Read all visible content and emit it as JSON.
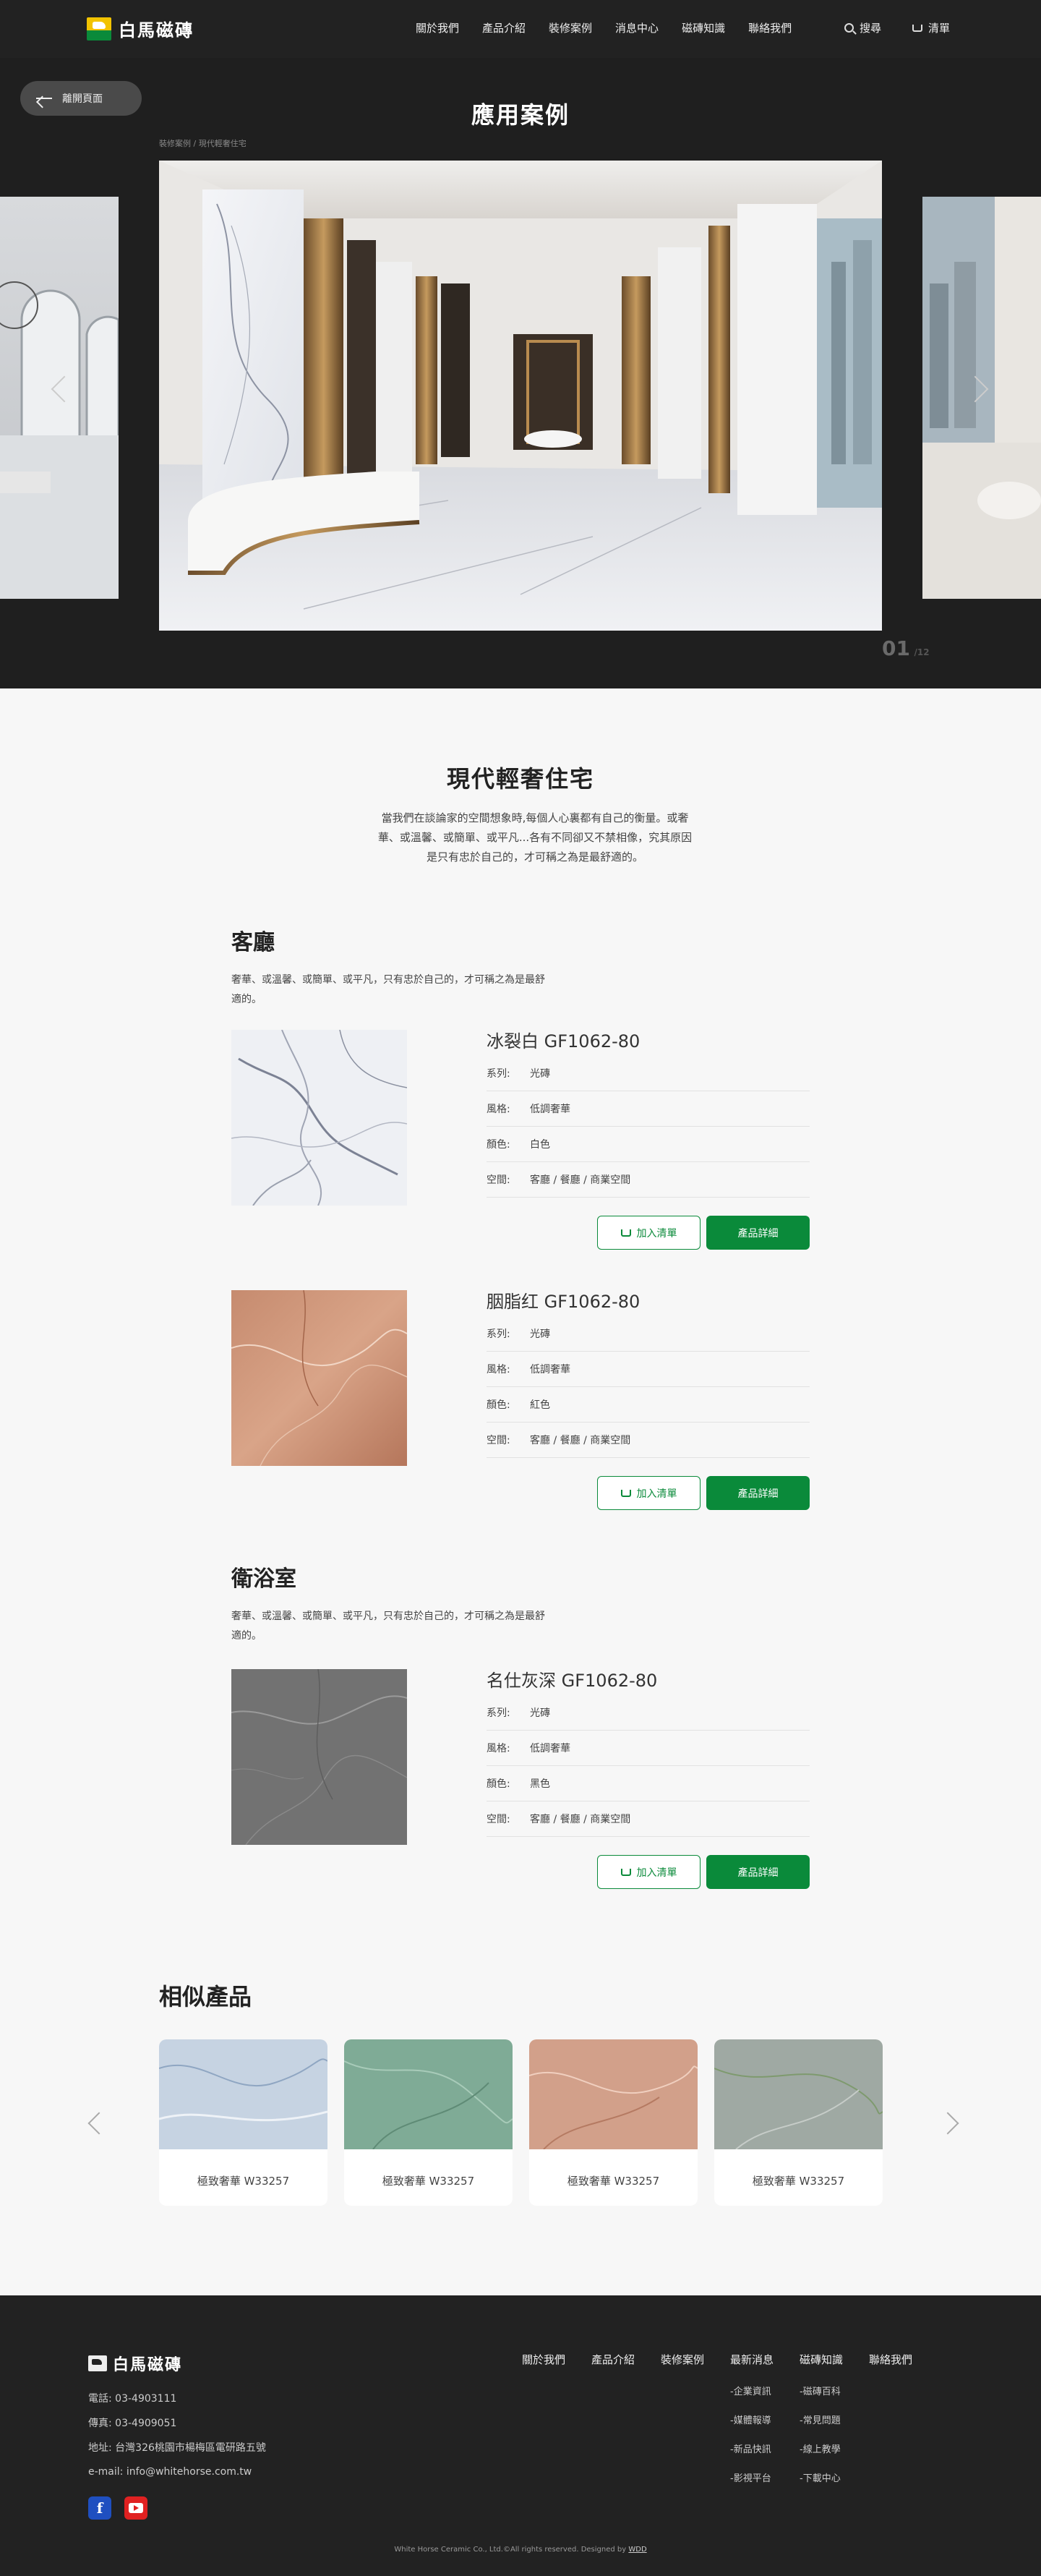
{
  "brand": {
    "name": "白馬磁磚"
  },
  "nav": {
    "items": [
      "關於我們",
      "產品介紹",
      "裝修案例",
      "消息中心",
      "磁磚知識",
      "聯絡我們"
    ],
    "search": "搜尋",
    "cart": "清單"
  },
  "hero": {
    "leave": "離開頁面",
    "title": "應用案例",
    "breadcrumb": "裝修案例 / 現代輕奢住宅",
    "current": "01",
    "total": "/12"
  },
  "intro": {
    "title": "現代輕奢住宅",
    "text": "當我們在談論家的空間想象時,每個人心裏都有自己的衡量。或奢華、或溫馨、或簡單、或平凡...各有不同卻又不禁相像，究其原因是只有忠於自己的，才可稱之為是最舒適的。"
  },
  "spec_labels": {
    "series": "系列:",
    "style": "風格:",
    "color": "顏色:",
    "space": "空間:"
  },
  "buttons": {
    "add": "加入清單",
    "detail": "產品詳細"
  },
  "sections": [
    {
      "title": "客廳",
      "desc": "奢華、或溫馨、或簡單、或平凡，只有忠於自己的，才可稱之為是最舒適的。",
      "products": [
        {
          "name": "冰裂白 GF1062-80",
          "series": "光磚",
          "style": "低調奢華",
          "color": "白色",
          "space": "客廳 / 餐廳 / 商業空間"
        },
        {
          "name": "胭脂红 GF1062-80",
          "series": "光磚",
          "style": "低調奢華",
          "color": "紅色",
          "space": "客廳 / 餐廳 / 商業空間"
        }
      ]
    },
    {
      "title": "衛浴室",
      "desc": "奢華、或溫馨、或簡單、或平凡，只有忠於自己的，才可稱之為是最舒適的。",
      "products": [
        {
          "name": "名仕灰深 GF1062-80",
          "series": "光磚",
          "style": "低調奢華",
          "color": "黑色",
          "space": "客廳 / 餐廳 / 商業空間"
        }
      ]
    }
  ],
  "similar": {
    "title": "相似產品",
    "items": [
      "極致奢華 W33257",
      "極致奢華 W33257",
      "極致奢華 W33257",
      "極致奢華 W33257"
    ]
  },
  "footer": {
    "brand": "白馬磁磚",
    "phone": "電話:  03-4903111",
    "fax": "傳真:  03-4909051",
    "address": "地址:  台灣326桃園市楊梅區電研路五號",
    "email": "e-mail:  info@whitehorse.com.tw",
    "nav": [
      "關於我們",
      "產品介紹",
      "裝修案例",
      "最新消息",
      "磁磚知識",
      "聯絡我們"
    ],
    "news_sub": [
      "-企業資訊",
      "-媒體報導",
      "-新品快訊",
      "-影視平台"
    ],
    "knowledge_sub": [
      "-磁磚百科",
      "-常見問題",
      "-線上教學",
      "-下載中心"
    ],
    "copyright": "White Horse Ceramic Co., Ltd.©All rights reserved. Designed by",
    "designer": "WDD"
  },
  "colors": {
    "brand_green": "#0a8a3a",
    "header_bg": "#222222",
    "hero_bg": "#1f1f1f"
  }
}
